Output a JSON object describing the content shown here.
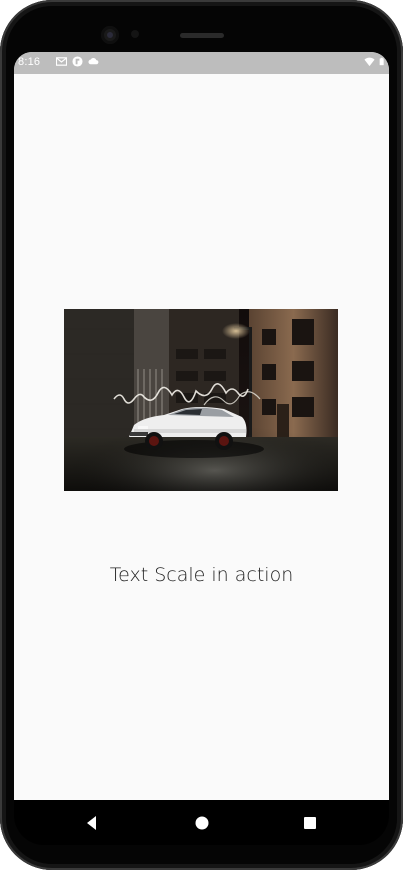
{
  "status_bar": {
    "time": "8:16",
    "left_icons": [
      "gmail-icon",
      "flipboard-icon",
      "cloud-icon"
    ],
    "right_icons": [
      "wifi-icon",
      "battery-icon"
    ]
  },
  "main": {
    "image": {
      "subject": "car-photo"
    },
    "caption": "Text Scale in action"
  },
  "nav_bar": {
    "buttons": [
      "back-icon",
      "home-icon",
      "recents-icon"
    ]
  },
  "colors": {
    "screen_bg": "#fafafa",
    "status_bar_bg": "#bdbdbd",
    "caption_text": "#222222",
    "nav_bar_bg": "#000000"
  }
}
